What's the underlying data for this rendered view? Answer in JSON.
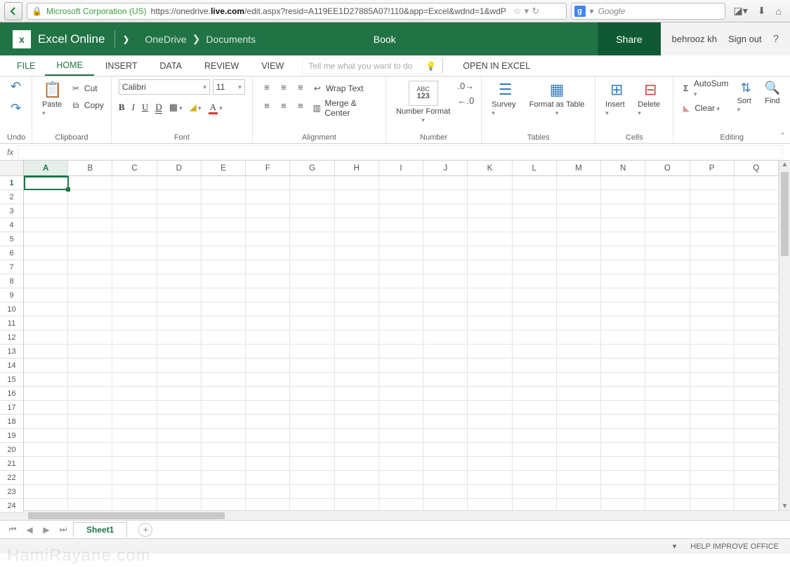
{
  "browser": {
    "corp": "Microsoft Corporation (US)",
    "url_prefix": "https://onedrive.",
    "url_bold": "live.com",
    "url_suffix": "/edit.aspx?resid=A119EE1D27885A07!110&app=Excel&wdnd=1&wdP",
    "search_placeholder": "Google"
  },
  "header": {
    "app_name": "Excel Online",
    "breadcrumb1": "OneDrive",
    "breadcrumb2": "Documents",
    "doc_title": "Book",
    "share": "Share",
    "user": "behrooz kh",
    "signout": "Sign out"
  },
  "tabs": {
    "file": "FILE",
    "home": "HOME",
    "insert": "INSERT",
    "data": "DATA",
    "review": "REVIEW",
    "view": "VIEW",
    "tellme": "Tell me what you want to do",
    "open_in": "OPEN IN EXCEL"
  },
  "ribbon": {
    "undo": {
      "label": "Undo"
    },
    "clipboard": {
      "paste": "Paste",
      "cut": "Cut",
      "copy": "Copy",
      "label": "Clipboard"
    },
    "font": {
      "name": "Calibri",
      "size": "11",
      "label": "Font"
    },
    "alignment": {
      "wrap": "Wrap Text",
      "merge": "Merge & Center",
      "label": "Alignment"
    },
    "number": {
      "format": "Number Format",
      "label": "Number"
    },
    "tables": {
      "survey": "Survey",
      "format_table": "Format as Table",
      "label": "Tables"
    },
    "cells": {
      "insert": "Insert",
      "delete": "Delete",
      "label": "Cells"
    },
    "editing": {
      "autosum": "AutoSum",
      "clear": "Clear",
      "sort": "Sort",
      "find": "Find",
      "label": "Editing"
    }
  },
  "grid": {
    "columns": [
      "A",
      "B",
      "C",
      "D",
      "E",
      "F",
      "G",
      "H",
      "I",
      "J",
      "K",
      "L",
      "M",
      "N",
      "O",
      "P",
      "Q"
    ],
    "rows": [
      "1",
      "2",
      "3",
      "4",
      "5",
      "6",
      "7",
      "8",
      "9",
      "10",
      "11",
      "12",
      "13",
      "14",
      "15",
      "16",
      "17",
      "18",
      "19",
      "20",
      "21",
      "22",
      "23",
      "24"
    ]
  },
  "sheets": {
    "sheet1": "Sheet1"
  },
  "status": {
    "help": "HELP IMPROVE OFFICE"
  },
  "watermark": "HamiRayane.com"
}
